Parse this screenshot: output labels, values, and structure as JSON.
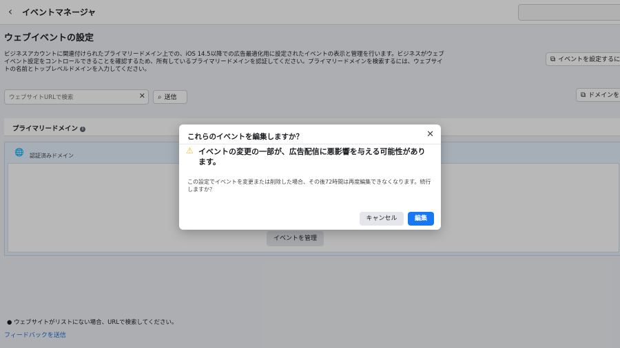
{
  "header": {
    "back_icon": "chevron-left-icon",
    "title": "イベントマネージャ"
  },
  "page": {
    "title": "ウェブイベントの設定",
    "description": "ビジネスアカウントに関連付けられたプライマリードメイン上での、iOS 14.5以降での広告最適化用に設定されたイベントの表示と管理を行います。ビジネスがウェブイベント設定をコントロールできることを確認するため、所有しているプライマリードメインを認証してください。プライマリードメインを検索するには、ウェブサイトの名前とトップレベルドメインを入力してください。",
    "setup_events_button": "イベントを設定するに",
    "domain_button": "ドメインを"
  },
  "search": {
    "placeholder": "ウェブサイトURLで検索",
    "value": "",
    "search_button": "送信"
  },
  "table": {
    "header_label": "プライマリードメイン",
    "panel_label": "認証済みドメイン",
    "manage_button": "イベントを管理"
  },
  "footer": {
    "note": "ウェブサイトがリストにない場合、URLで検索してください。",
    "feedback_link": "フィードバックを送信"
  },
  "modal": {
    "title": "これらのイベントを編集しますか？",
    "warning": "イベントの変更の一部が、広告配信に悪影響を与える可能性があります。",
    "body": "この設定でイベントを変更または削除した場合、その後72時間は再度編集できなくなります。続行しますか？",
    "cancel_label": "キャンセル",
    "edit_label": "編集"
  },
  "colors": {
    "primary": "#1877f2",
    "warning": "#f7b928",
    "panel_bg": "#e7f3ff"
  }
}
